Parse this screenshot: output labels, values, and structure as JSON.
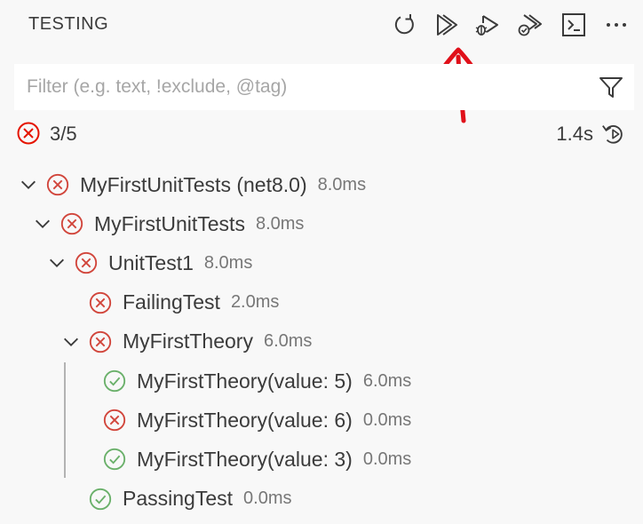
{
  "header": {
    "title": "TESTING",
    "toolbar": [
      {
        "name": "refresh-tests-button",
        "icon": "refresh-icon"
      },
      {
        "name": "run-tests-button",
        "icon": "run-all-icon"
      },
      {
        "name": "debug-tests-button",
        "icon": "debug-run-icon"
      },
      {
        "name": "run-coverage-button",
        "icon": "coverage-run-icon"
      },
      {
        "name": "show-output-button",
        "icon": "terminal-icon"
      },
      {
        "name": "more-actions-button",
        "icon": "ellipsis-icon"
      }
    ]
  },
  "filter": {
    "placeholder": "Filter (e.g. text, !exclude, @tag)",
    "value": ""
  },
  "summary": {
    "status_icon": "error-icon",
    "count": "3/5",
    "duration": "1.4s",
    "rerun_icon": "rerun-icon"
  },
  "tree": [
    {
      "label": "MyFirstUnitTests (net8.0)",
      "duration": "8.0ms",
      "status": "failed",
      "expanded": true,
      "depth": 0
    },
    {
      "label": "MyFirstUnitTests",
      "duration": "8.0ms",
      "status": "failed",
      "expanded": true,
      "depth": 1
    },
    {
      "label": "UnitTest1",
      "duration": "8.0ms",
      "status": "failed",
      "expanded": true,
      "depth": 2
    },
    {
      "label": "FailingTest",
      "duration": "2.0ms",
      "status": "failed",
      "expanded": null,
      "depth": 3
    },
    {
      "label": "MyFirstTheory",
      "duration": "6.0ms",
      "status": "failed",
      "expanded": true,
      "depth": 3
    },
    {
      "label": "MyFirstTheory(value: 5)",
      "duration": "6.0ms",
      "status": "passed",
      "expanded": null,
      "depth": 4
    },
    {
      "label": "MyFirstTheory(value: 6)",
      "duration": "0.0ms",
      "status": "failed",
      "expanded": null,
      "depth": 4
    },
    {
      "label": "MyFirstTheory(value: 3)",
      "duration": "0.0ms",
      "status": "passed",
      "expanded": null,
      "depth": 4
    },
    {
      "label": "PassingTest",
      "duration": "0.0ms",
      "status": "passed",
      "expanded": null,
      "depth": 3
    }
  ],
  "colors": {
    "failed": "#e51400",
    "failed_soft": "#d1453b",
    "passed": "#388a34",
    "passed_soft": "#6ab06a",
    "annotation": "#e0101a",
    "background": "#f8f8f8"
  }
}
